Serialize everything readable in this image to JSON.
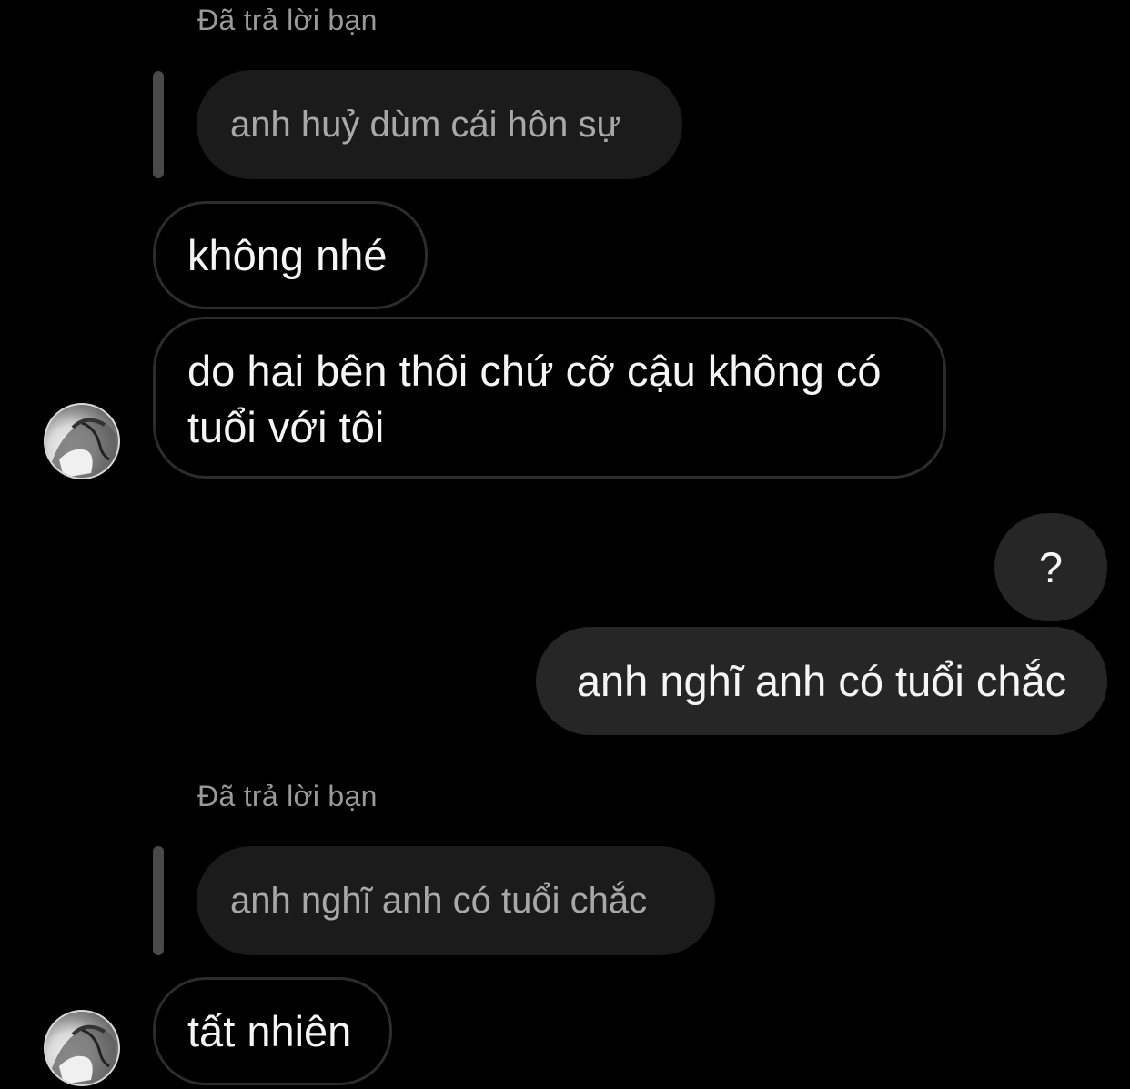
{
  "thread": {
    "reply_label_1": "Đã trả lời bạn",
    "quoted_1": "anh huỷ dùm cái hôn sự",
    "msg_khong_nhe": "không nhé",
    "msg_do_hai_ben": "do hai bên thôi chứ cỡ cậu không có tuổi với tôi",
    "msg_question": "?",
    "msg_anh_nghi": "anh nghĩ anh có tuổi chắc",
    "reply_label_2": "Đã trả lời bạn",
    "quoted_2": "anh nghĩ anh có tuổi chắc",
    "msg_tat_nhien": "tất nhiên"
  },
  "icons": {
    "avatar": "profile-avatar-icon"
  },
  "colors": {
    "background": "#000000",
    "incoming_border": "#2c2c2c",
    "outgoing_bubble": "#262626",
    "quoted_bubble": "#1b1b1b",
    "reply_bar": "#4a4a4a",
    "secondary_text": "#9a9a9a"
  }
}
